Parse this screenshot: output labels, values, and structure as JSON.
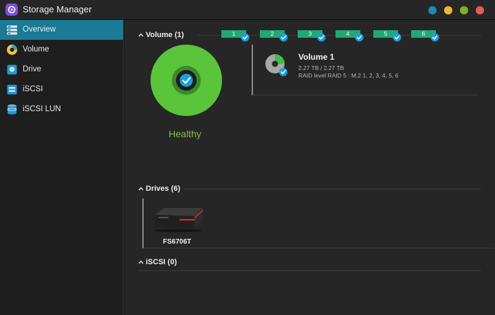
{
  "app": {
    "title": "Storage Manager"
  },
  "window_controls": [
    {
      "name": "window-dot-teal",
      "color": "#1a8bb0"
    },
    {
      "name": "window-dot-yellow",
      "color": "#f2b52d"
    },
    {
      "name": "window-dot-green",
      "color": "#7fae2f"
    },
    {
      "name": "window-dot-red",
      "color": "#e85a57"
    }
  ],
  "sidebar": {
    "items": [
      {
        "label": "Overview",
        "icon": "overview-icon",
        "active": true
      },
      {
        "label": "Volume",
        "icon": "volume-icon",
        "active": false
      },
      {
        "label": "Drive",
        "icon": "drive-icon",
        "active": false
      },
      {
        "label": "iSCSI",
        "icon": "iscsi-icon",
        "active": false
      },
      {
        "label": "iSCSI LUN",
        "icon": "iscsi-lun-icon",
        "active": false
      }
    ]
  },
  "volume_section": {
    "header": "Volume (1)",
    "status": "Healthy",
    "volume": {
      "name": "Volume 1",
      "capacity": "2.27 TB / 2.27 TB",
      "raid": "RAID level RAID 5 : M.2 1, 2, 3, 4, 5, 6"
    }
  },
  "drives_section": {
    "header": "Drives (6)",
    "model": "FS6706T",
    "slots": [
      "1",
      "2",
      "3",
      "4",
      "5",
      "6"
    ]
  },
  "iscsi_section": {
    "header": "iSCSI (0)"
  },
  "colors": {
    "accent": "#1b7a96",
    "healthy": "#7cc242",
    "slot": "#22a875",
    "check": "#1ba0d8"
  }
}
